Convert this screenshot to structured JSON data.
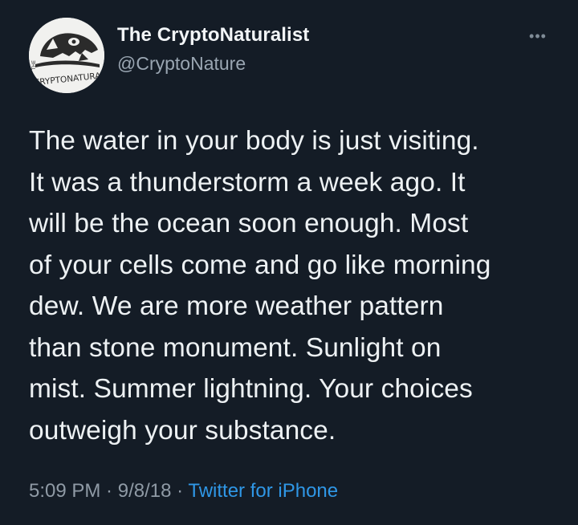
{
  "author": {
    "display_name": "The CryptoNaturalist",
    "handle": "@CryptoNature",
    "avatar_text": "CRYPTONATURALIST",
    "avatar_prefix": "THE"
  },
  "more_label": "•••",
  "tweet": {
    "text": "The water in your body is just visiting.\nIt was a thunderstorm a week ago. It\nwill be the ocean soon enough. Most\nof your cells come and go like morning\ndew. We are more weather pattern\nthan stone monument. Sunlight on\nmist. Summer lightning. Your choices\noutweigh your substance."
  },
  "meta": {
    "time": "5:09 PM",
    "separator1": " · ",
    "date": "9/8/18",
    "separator2": " · ",
    "source": "Twitter for iPhone"
  },
  "colors": {
    "background": "#141c26",
    "text": "#edf1f3",
    "secondary": "#8f9aa5",
    "link": "#2f97e6"
  }
}
